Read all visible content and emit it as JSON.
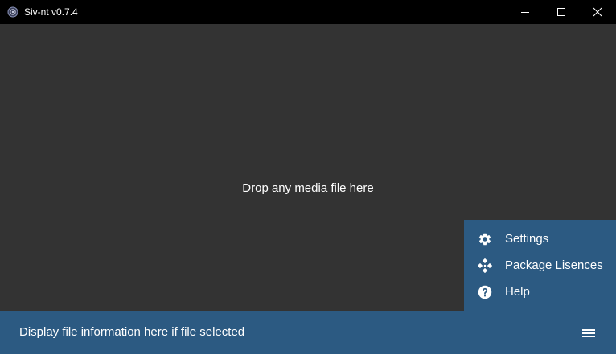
{
  "window": {
    "title": "Siv-nt v0.7.4",
    "app_icon": "app-logo-icon",
    "controls": {
      "minimize_icon": "minimize-icon",
      "maximize_icon": "maximize-icon",
      "close_icon": "close-icon"
    }
  },
  "main": {
    "drop_text": "Drop any media file here"
  },
  "menu": {
    "items": [
      {
        "label": "Settings",
        "icon": "gear-icon"
      },
      {
        "label": "Package Lisences",
        "icon": "package-icon"
      },
      {
        "label": "Help",
        "icon": "help-icon"
      }
    ]
  },
  "bottombar": {
    "file_info": "Display file information here if file selected",
    "menu_icon": "hamburger-icon"
  },
  "colors": {
    "titlebar": "#000000",
    "background": "#333333",
    "accent": "#2c5a82",
    "text": "#ffffff"
  }
}
